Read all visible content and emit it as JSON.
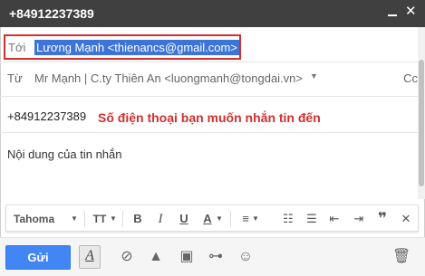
{
  "window": {
    "title": "+84912237389"
  },
  "recipient": {
    "label": "Tới",
    "value": "Lương Mạnh <thienancs@gmail.com>"
  },
  "sender": {
    "label": "Từ",
    "value": "Mr Mạnh | C.ty Thiên An <luongmanh@tongdai.vn>",
    "cc_label": "Cc"
  },
  "subject_field": {
    "value": "+84912237389"
  },
  "annotation": {
    "text": "Số điện thoại bạn muốn nhắn tin đến"
  },
  "message": {
    "body": "Nội dung của tin nhắn"
  },
  "toolbar": {
    "font_name": "Tahoma",
    "font_size_icon": "TT",
    "bold": "B",
    "italic": "I",
    "underline": "U",
    "text_color": "A"
  },
  "actions": {
    "send_label": "Gửi",
    "format_label": "A"
  },
  "colors": {
    "title_bar": "#404040",
    "send_button": "#4285f4",
    "highlight_box": "#d32f2f",
    "selection": "#3d74d9",
    "annotation": "#d32f2f"
  }
}
